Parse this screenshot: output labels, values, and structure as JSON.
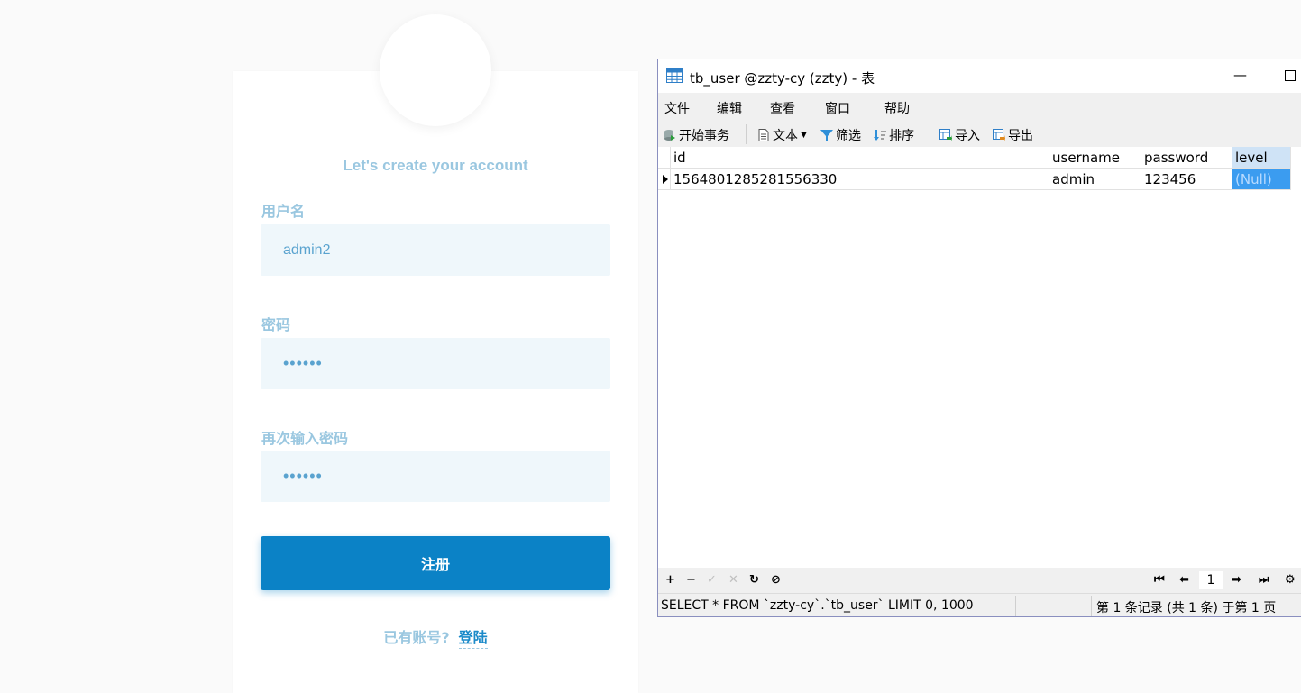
{
  "register": {
    "title": "Let's create your account",
    "username_label": "用户名",
    "username_value": "admin2",
    "password_label": "密码",
    "password_value": "••••••",
    "confirm_label": "再次输入密码",
    "confirm_value": "••••••",
    "submit_label": "注册",
    "footer_question": "已有账号?",
    "footer_link": "登陆"
  },
  "dbwindow": {
    "title": "tb_user @zzty-cy (zzty) - 表",
    "minimize_icon": "—",
    "menu": [
      "文件",
      "编辑",
      "查看",
      "窗口",
      "帮助"
    ],
    "toolbar": {
      "begin_tx": "开始事务",
      "text": "文本",
      "filter": "筛选",
      "sort": "排序",
      "import": "导入",
      "export": "导出"
    },
    "columns": [
      "id",
      "username",
      "password",
      "level"
    ],
    "rows": [
      [
        "1564801285281556330",
        "admin",
        "123456",
        "(Null)"
      ]
    ],
    "nav": {
      "add": "+",
      "remove": "−",
      "apply": "✓",
      "cancel": "✕",
      "refresh": "↻",
      "stop": "⊘",
      "first": "⏮",
      "prev": "⬅",
      "page": "1",
      "next": "➡",
      "last": "⏭",
      "settings": "⚙"
    },
    "status": {
      "sql": "SELECT * FROM `zzty-cy`.`tb_user` LIMIT 0, 1000",
      "records": "第 1 条记录 (共 1 条) 于第 1 页"
    }
  }
}
